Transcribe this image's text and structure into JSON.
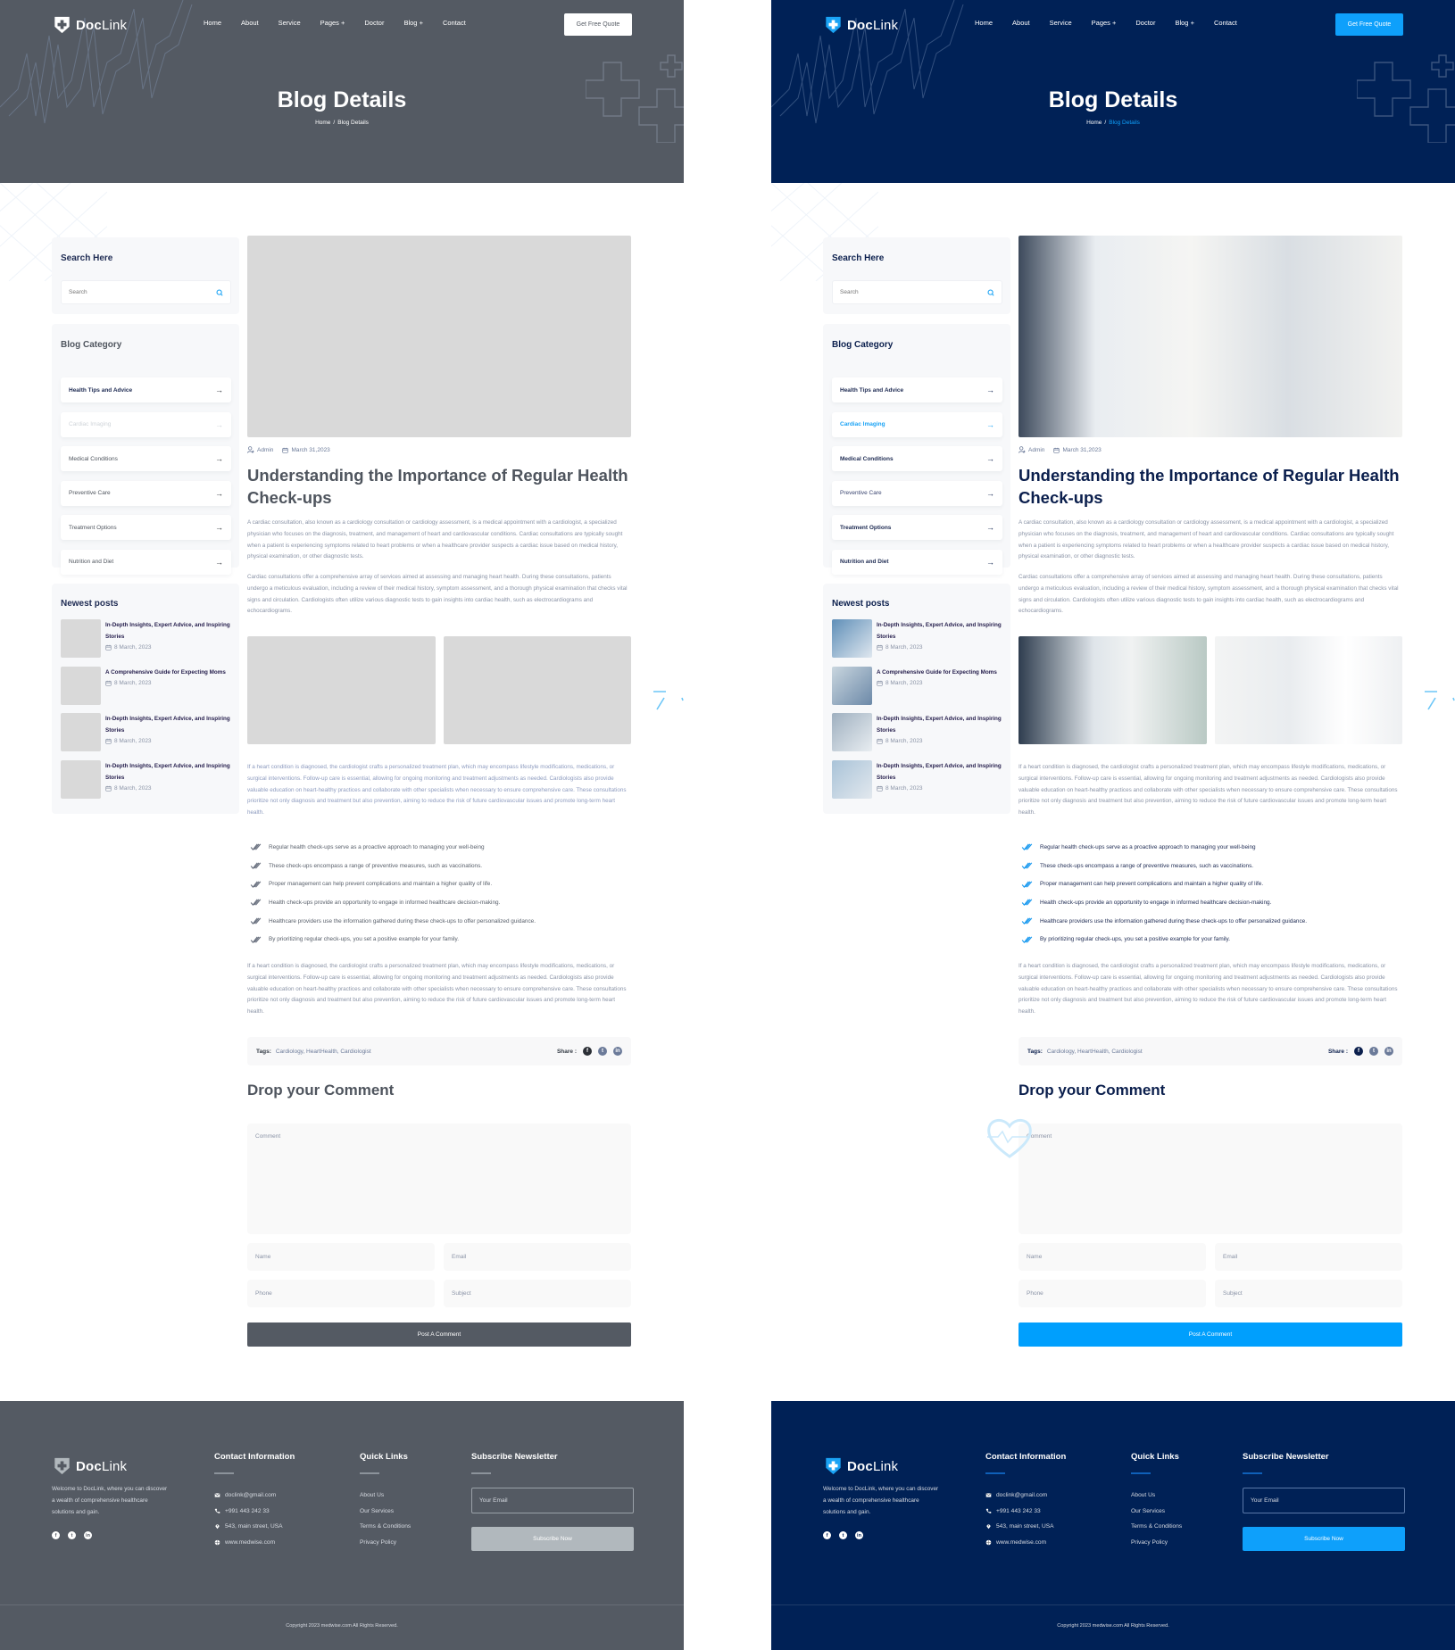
{
  "brand": {
    "name_bold": "Doc",
    "name_light": "Link"
  },
  "nav": {
    "items": [
      "Home",
      "About",
      "Service",
      "Pages +",
      "Doctor",
      "Blog +",
      "Contact"
    ],
    "cta": "Get Free Quote"
  },
  "hero": {
    "title": "Blog Details",
    "breadcrumb": [
      "Home",
      "/",
      "Blog Details"
    ]
  },
  "sidebar": {
    "search": {
      "title": "Search Here",
      "placeholder": "Search"
    },
    "categories": {
      "title": "Blog Category",
      "items": [
        "Health Tips and Advice",
        "Cardiac Imaging",
        "Medical Conditions",
        "Preventive Care",
        "Treatment Options",
        "Nutrition and Diet"
      ],
      "active_item": "Cardiac Imaging"
    },
    "newest": {
      "title": "Newest posts",
      "posts": [
        {
          "title": "In-Depth Insights, Expert Advice, and Inspiring Stories",
          "date": "8 March, 2023"
        },
        {
          "title": "A Comprehensive Guide for Expecting Moms",
          "date": "8 March, 2023"
        },
        {
          "title": "In-Depth Insights, Expert Advice, and Inspiring Stories",
          "date": "8 March, 2023"
        },
        {
          "title": "In-Depth Insights, Expert Advice, and Inspiring Stories",
          "date": "8 March, 2023"
        }
      ]
    }
  },
  "article": {
    "author": "Admin",
    "date": "March 31,2023",
    "title": "Understanding the Importance of Regular Health Check-ups",
    "paragraphs": [
      "A cardiac consultation, also known as a cardiology consultation or cardiology assessment, is a medical appointment with a cardiologist, a specialized physician who focuses on the diagnosis, treatment, and management of heart and cardiovascular conditions. Cardiac consultations are typically sought when a patient is experiencing symptoms related to heart problems or when a healthcare provider suspects a cardiac issue based on medical history, physical examination, or other diagnostic tests.",
      "Cardiac consultations offer a comprehensive array of services aimed at assessing and managing heart health. During these consultations, patients undergo a meticulous evaluation, including a review of their medical history, symptom assessment, and a thorough physical examination that checks vital signs and circulation. Cardiologists often utilize various diagnostic tests to gain insights into cardiac health, such as electrocardiograms and echocardiograms.",
      "If a heart condition is diagnosed, the cardiologist crafts a personalized treatment plan, which may encompass lifestyle modifications, medications, or surgical interventions. Follow-up care is essential, allowing for ongoing monitoring and treatment adjustments as needed. Cardiologists also provide valuable education on heart-healthy practices and collaborate with other specialists when necessary to ensure comprehensive care. These consultations prioritize not only diagnosis and treatment but also prevention, aiming to reduce the risk of future cardiovascular issues and promote long-term heart health.",
      "If a heart condition is diagnosed, the cardiologist crafts a personalized treatment plan, which may encompass lifestyle modifications, medications, or surgical interventions. Follow-up care is essential, allowing for ongoing monitoring and treatment adjustments as needed. Cardiologists also provide valuable education on heart-healthy practices and collaborate with other specialists when necessary to ensure comprehensive care. These consultations prioritize not only diagnosis and treatment but also prevention, aiming to reduce the risk of future cardiovascular issues and promote long-term heart health."
    ],
    "checklist": [
      "Regular health check-ups serve as a proactive approach to managing your well-being",
      "These check-ups encompass a range of preventive measures, such as vaccinations.",
      "Proper management can help prevent complications and maintain a higher quality of life.",
      "Health check-ups provide an opportunity to engage in informed healthcare decision-making.",
      "Healthcare providers use the information gathered during these check-ups to offer personalized guidance.",
      "By prioritizing regular check-ups, you set a positive example for your family."
    ],
    "tags_label": "Tags:",
    "tags": "Cardiology, HeartHealth, Cardiologist",
    "share_label": "Share :",
    "share_icons": [
      "facebook-icon",
      "twitter-icon",
      "linkedin-icon"
    ]
  },
  "comment_form": {
    "title": "Drop your Comment",
    "comment_placeholder": "Comment",
    "name_placeholder": "Name",
    "email_placeholder": "Email",
    "phone_placeholder": "Phone",
    "subject_placeholder": "Subject",
    "submit": "Post A Comment"
  },
  "footer": {
    "about": "Welcome to DocLink, where you can discover a wealth of comprehensive healthcare solutions and gain.",
    "contact_title": "Contact Information",
    "contact": [
      {
        "icon": "mail-icon",
        "text": "doclink@gmail.com"
      },
      {
        "icon": "phone-icon",
        "text": "+991 443 242 33"
      },
      {
        "icon": "location-icon",
        "text": "543, main street, USA"
      },
      {
        "icon": "globe-icon",
        "text": "www.medwise.com"
      }
    ],
    "links_title": "Quick Links",
    "links": [
      "About Us",
      "Our Services",
      "Terms & Conditions",
      "Privacy Policy"
    ],
    "newsletter_title": "Subscribe Newsletter",
    "email_placeholder": "Your Email",
    "subscribe": "Subscribe Now",
    "copyright": "Copyright 2023 medwise.com All Rights Reserved."
  },
  "themes": {
    "wireframe": {
      "dark": "#545a63",
      "accent": "#545a63",
      "image_placeholder": "#d9d9d9"
    },
    "color": {
      "dark": "#002156",
      "accent": "#009ffd",
      "navy_text": "#0b1f4d"
    }
  }
}
